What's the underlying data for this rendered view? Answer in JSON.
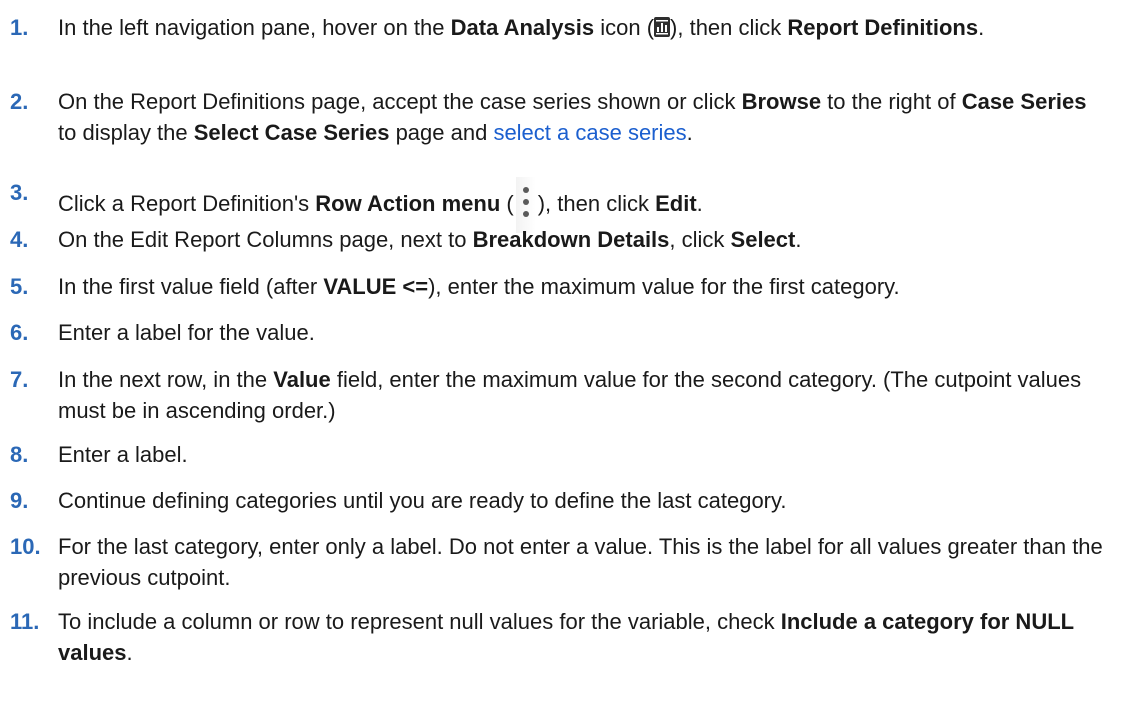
{
  "steps": [
    {
      "n": "1.",
      "p0": "In the left navigation pane, hover on the ",
      "b0": "Data Analysis",
      "p1": " icon (",
      "p2": "), then click ",
      "b1": "Report Definitions",
      "p3": "."
    },
    {
      "n": "2.",
      "p0": "On the Report Definitions page, accept the case series shown or click ",
      "b0": "Browse",
      "p1": " to the right of ",
      "b1": "Case Series",
      "p2": " to display the ",
      "b2": "Select Case Series",
      "p3": " page and ",
      "link": "select a case series",
      "p4": "."
    },
    {
      "n": "3.",
      "p0": "Click a Report Definition's ",
      "b0": "Row Action menu",
      "p1": " (",
      "p2": "), then click ",
      "b1": "Edit",
      "p3": "."
    },
    {
      "n": "4.",
      "p0": "On the Edit Report Columns page, next to ",
      "b0": "Breakdown Details",
      "p1": ", click ",
      "b1": "Select",
      "p2": "."
    },
    {
      "n": "5.",
      "p0": "In the first value field (after ",
      "b0": "VALUE <=",
      "p1": "), enter the maximum value for the first category."
    },
    {
      "n": "6.",
      "p0": "Enter a label for the value."
    },
    {
      "n": "7.",
      "p0": "In the next row, in the ",
      "b0": "Value",
      "p1": " field, enter the maximum value for the second category. (The cutpoint values must be in ascending order.)"
    },
    {
      "n": "8.",
      "p0": "Enter a label."
    },
    {
      "n": "9.",
      "p0": "Continue defining categories until you are ready to define the last category."
    },
    {
      "n": "10.",
      "p0": "For the last category, enter only a label. Do not enter a value. This is the label for all values greater than the previous cutpoint."
    },
    {
      "n": "11.",
      "p0": "To include a column or row to represent null values for the variable, check ",
      "b0": "Include a category for NULL values",
      "p1": "."
    }
  ],
  "icons": {
    "step1": "data-analysis-icon",
    "step3": "row-action-menu-icon"
  }
}
